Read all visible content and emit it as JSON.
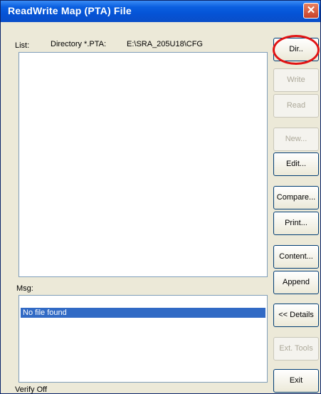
{
  "window": {
    "title": "ReadWrite Map (PTA)  File",
    "close_glyph": "✕"
  },
  "list": {
    "label": "List:",
    "dir_label": "Directory *.PTA:",
    "dir_path": "E:\\SRA_205U18\\CFG"
  },
  "msg": {
    "label": "Msg:",
    "selected_row": "No file found"
  },
  "buttons": {
    "dir": "Dir..",
    "write": "Write",
    "read": "Read",
    "new": "New...",
    "edit": "Edit...",
    "compare": "Compare...",
    "print": "Print...",
    "content": "Content...",
    "append": "Append",
    "details": "<< Details",
    "ext_tools": "Ext. Tools",
    "exit": "Exit"
  },
  "status": {
    "verify": "Verify Off"
  },
  "colors": {
    "titlebar": "#0553d6",
    "selection": "#316ac5",
    "highlight_circle": "#e21414"
  }
}
